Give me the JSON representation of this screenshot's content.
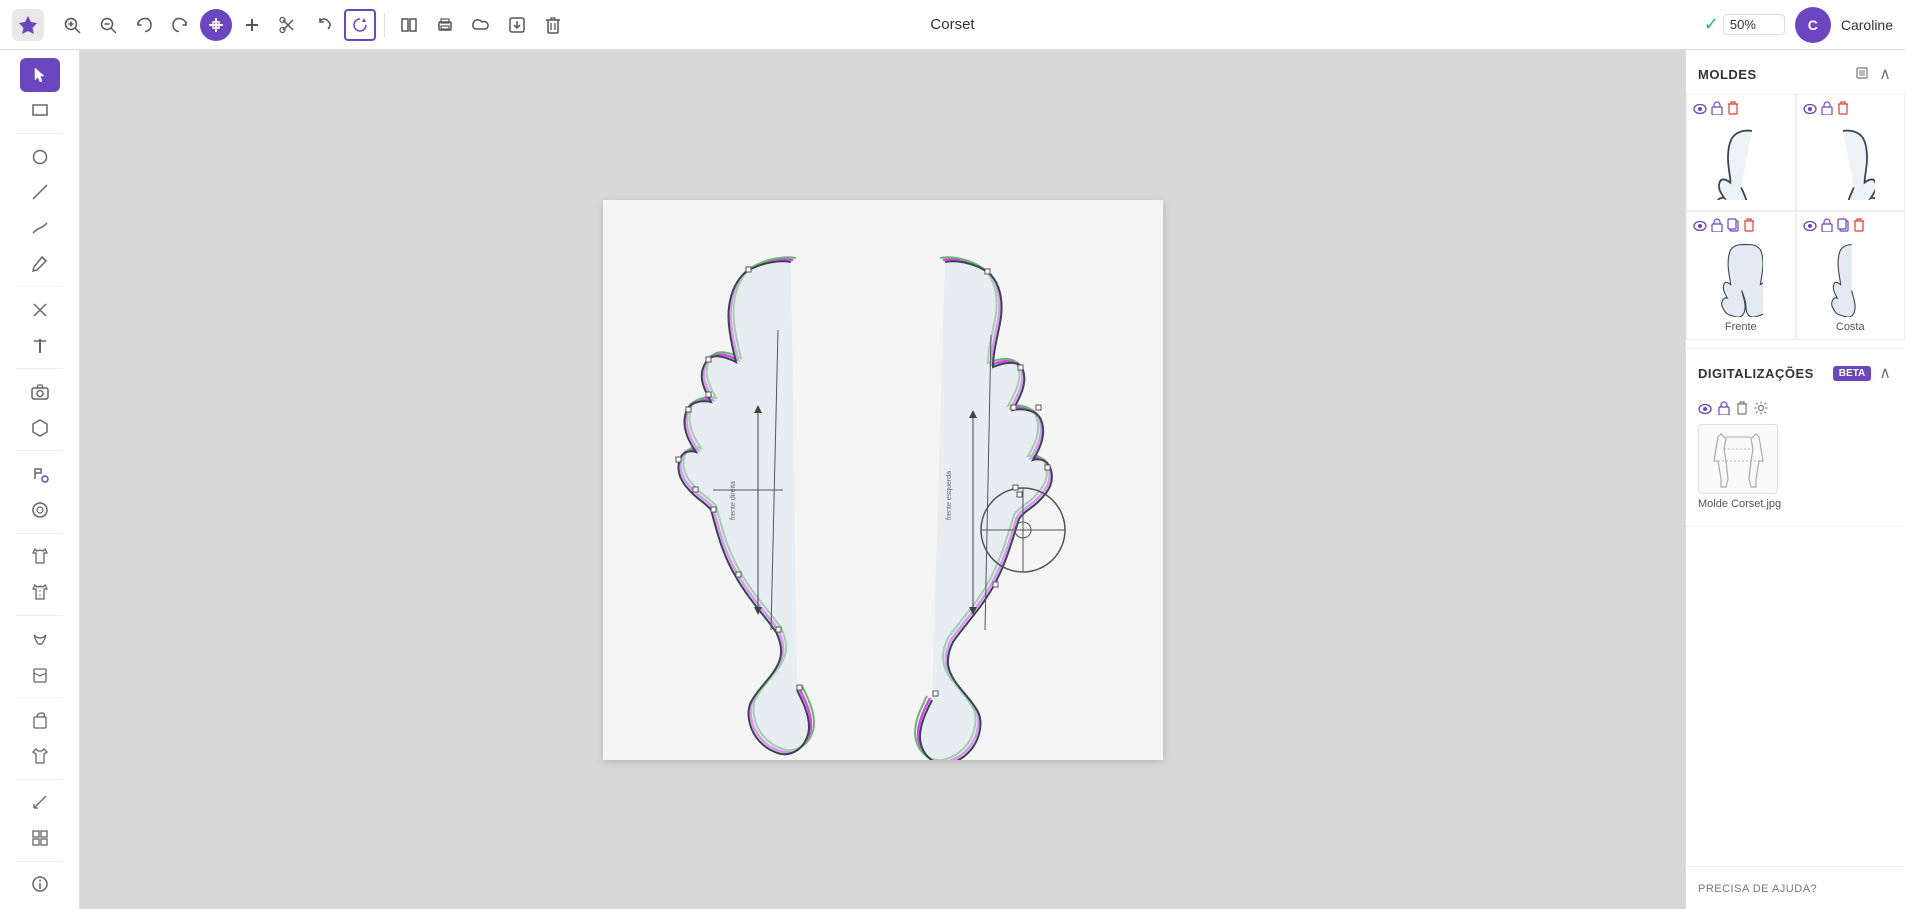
{
  "app": {
    "logo_letter": "✦",
    "title": "Corset"
  },
  "toolbar": {
    "tools": [
      {
        "id": "zoom-in",
        "icon": "🔍",
        "label": "Zoom In",
        "active": false,
        "symbol": "+"
      },
      {
        "id": "zoom-out",
        "icon": "🔍",
        "label": "Zoom Out",
        "active": false,
        "symbol": "−"
      },
      {
        "id": "undo",
        "icon": "↩",
        "label": "Undo",
        "active": false
      },
      {
        "id": "redo",
        "icon": "↪",
        "label": "Redo",
        "active": false
      },
      {
        "id": "select",
        "icon": "⌂",
        "label": "Select/Move",
        "active": true
      },
      {
        "id": "add",
        "icon": "+",
        "label": "Add",
        "active": false
      },
      {
        "id": "cut",
        "icon": "✂",
        "label": "Cut",
        "active": false
      },
      {
        "id": "rotate",
        "icon": "↺",
        "label": "Rotate",
        "active": false
      },
      {
        "id": "refresh",
        "icon": "↺",
        "label": "Refresh",
        "active": false
      },
      {
        "id": "layers",
        "icon": "▦",
        "label": "Layers",
        "active": false
      },
      {
        "id": "print",
        "icon": "🖨",
        "label": "Print",
        "active": false
      },
      {
        "id": "export",
        "icon": "📤",
        "label": "Export",
        "active": false
      },
      {
        "id": "delete",
        "icon": "🗑",
        "label": "Delete",
        "active": false
      }
    ],
    "zoom_level": "50%",
    "zoom_check": "✓",
    "user": {
      "initial": "C",
      "name": "Caroline"
    }
  },
  "left_sidebar": {
    "tools": [
      {
        "id": "pointer",
        "icon": "▶",
        "label": "Pointer",
        "active": true
      },
      {
        "id": "rectangle",
        "icon": "▭",
        "label": "Rectangle",
        "active": false
      },
      {
        "id": "circle",
        "icon": "○",
        "label": "Circle",
        "active": false
      },
      {
        "id": "line",
        "icon": "╱",
        "label": "Line",
        "active": false
      },
      {
        "id": "pen",
        "icon": "✏",
        "label": "Pen",
        "active": false
      },
      {
        "id": "pencil",
        "icon": "✒",
        "label": "Pencil",
        "active": false
      },
      {
        "id": "cross",
        "icon": "✕",
        "label": "Cross",
        "active": false
      },
      {
        "id": "text",
        "icon": "T",
        "label": "Text",
        "active": false
      },
      {
        "id": "camera",
        "icon": "📷",
        "label": "Camera",
        "active": false
      },
      {
        "id": "shape5",
        "icon": "⬡",
        "label": "Shape",
        "active": false
      },
      {
        "id": "paint",
        "icon": "🎨",
        "label": "Paint",
        "active": false
      },
      {
        "id": "thread",
        "icon": "◎",
        "label": "Thread",
        "active": false
      },
      {
        "id": "garment1",
        "icon": "👕",
        "label": "Garment Front",
        "active": false
      },
      {
        "id": "garment2",
        "icon": "👕",
        "label": "Garment Back",
        "active": false
      },
      {
        "id": "collar",
        "icon": "⌒",
        "label": "Collar",
        "active": false
      },
      {
        "id": "pocket",
        "icon": "▭",
        "label": "Pocket",
        "active": false
      },
      {
        "id": "sleeve",
        "icon": "👕",
        "label": "Sleeve",
        "active": false
      },
      {
        "id": "shirt",
        "icon": "👔",
        "label": "Shirt",
        "active": false
      },
      {
        "id": "bag",
        "icon": "👜",
        "label": "Bag",
        "active": false
      },
      {
        "id": "tshirt",
        "icon": "👕",
        "label": "T-Shirt",
        "active": false
      },
      {
        "id": "measure",
        "icon": "📐",
        "label": "Measure",
        "active": false
      },
      {
        "id": "grid",
        "icon": "⊞",
        "label": "Grid",
        "active": false
      },
      {
        "id": "help2",
        "icon": "ℹ",
        "label": "Help",
        "active": false
      }
    ]
  },
  "right_panel": {
    "moldes": {
      "title": "MOLDES",
      "items": [
        {
          "id": "molde1",
          "label": "",
          "has_eye": true,
          "has_lock": true,
          "has_delete": true
        },
        {
          "id": "molde2",
          "label": "",
          "has_eye": true,
          "has_lock": true,
          "has_delete": true
        },
        {
          "id": "molde3",
          "label": "Frente",
          "has_eye": true,
          "has_lock": true,
          "has_delete": true
        },
        {
          "id": "molde4",
          "label": "Costa",
          "has_eye": true,
          "has_lock": true,
          "has_delete": true
        }
      ]
    },
    "digitalizacoes": {
      "title": "DIGITALIZAÇÕES",
      "beta_label": "BETA",
      "items": [
        {
          "id": "digit1",
          "label": "Molde Corset.jpg",
          "has_eye": true,
          "has_lock": true,
          "has_delete": true,
          "has_settings": true
        }
      ]
    },
    "help": {
      "label": "PRECISA DE AJUDA?"
    }
  }
}
